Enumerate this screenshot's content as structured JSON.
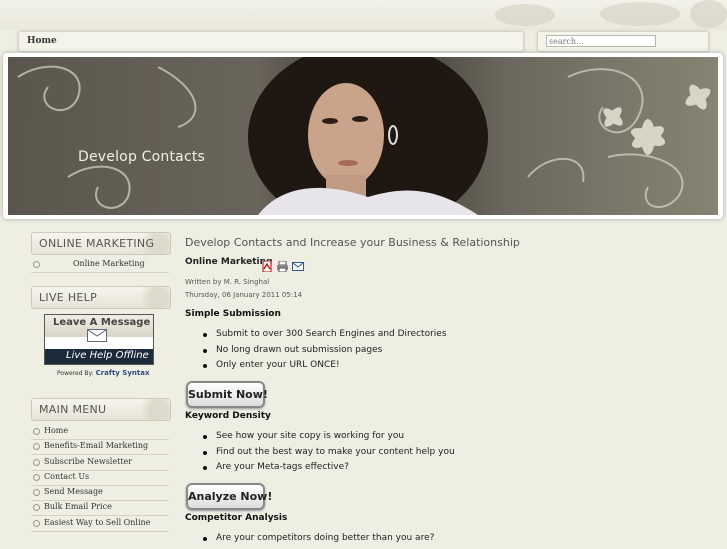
{
  "top_nav": {
    "home_label": "Home"
  },
  "search": {
    "placeholder": "search..."
  },
  "banner": {
    "title": "Develop Contacts"
  },
  "sidebar": {
    "online_marketing": {
      "heading": "ONLINE MARKETING",
      "items": [
        "Online Marketing"
      ]
    },
    "live_help": {
      "heading": "LIVE HELP",
      "leave_message": "Leave A Message",
      "status": "Live Help Offline",
      "powered_by_prefix": "Powered By:",
      "powered_by_brand": "Crafty Syntax"
    },
    "main_menu": {
      "heading": "MAIN MENU",
      "items": [
        "Home",
        "Benefits-Email Marketing",
        "Subscribe Newsletter",
        "Contact Us",
        "Send Message",
        "Bulk Email Price",
        "Easiest Way to Sell Online"
      ]
    }
  },
  "content": {
    "page_title": "Develop Contacts and Increase your Business & Relationship",
    "article_title": "Online Marketing",
    "icons": [
      "pdf-icon",
      "print-icon",
      "email-icon"
    ],
    "author": "Written by M. R. Singhal",
    "date": "Thursday, 06 January 2011 05:14",
    "sections": [
      {
        "heading": "Simple Submission",
        "bullets": [
          "Submit to over 300 Search Engines and Directories",
          "No long drawn out submission pages",
          "Only enter your URL ONCE!"
        ],
        "button": "Submit Now!"
      },
      {
        "heading": "Keyword Density",
        "bullets": [
          "See how your site copy is working for you",
          "Find out the best way to make your content help you",
          "Are your Meta-tags effective?"
        ],
        "button": "Analyze Now!"
      },
      {
        "heading": "Competitor Analysis",
        "bullets": [
          "Are your competitors doing better than you are?"
        ]
      }
    ]
  }
}
